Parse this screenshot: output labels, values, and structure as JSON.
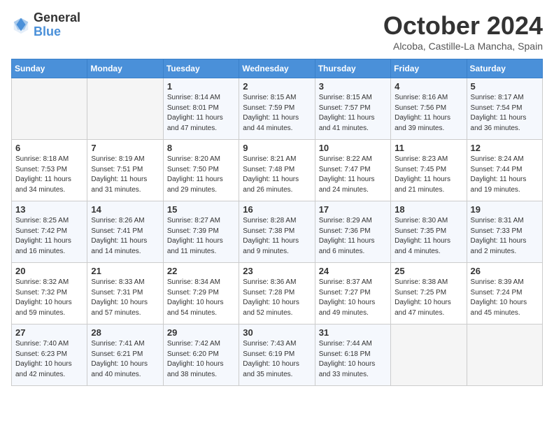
{
  "header": {
    "logo_line1": "General",
    "logo_line2": "Blue",
    "month": "October 2024",
    "location": "Alcoba, Castille-La Mancha, Spain"
  },
  "weekdays": [
    "Sunday",
    "Monday",
    "Tuesday",
    "Wednesday",
    "Thursday",
    "Friday",
    "Saturday"
  ],
  "weeks": [
    [
      {
        "day": "",
        "info": ""
      },
      {
        "day": "",
        "info": ""
      },
      {
        "day": "1",
        "info": "Sunrise: 8:14 AM\nSunset: 8:01 PM\nDaylight: 11 hours and 47 minutes."
      },
      {
        "day": "2",
        "info": "Sunrise: 8:15 AM\nSunset: 7:59 PM\nDaylight: 11 hours and 44 minutes."
      },
      {
        "day": "3",
        "info": "Sunrise: 8:15 AM\nSunset: 7:57 PM\nDaylight: 11 hours and 41 minutes."
      },
      {
        "day": "4",
        "info": "Sunrise: 8:16 AM\nSunset: 7:56 PM\nDaylight: 11 hours and 39 minutes."
      },
      {
        "day": "5",
        "info": "Sunrise: 8:17 AM\nSunset: 7:54 PM\nDaylight: 11 hours and 36 minutes."
      }
    ],
    [
      {
        "day": "6",
        "info": "Sunrise: 8:18 AM\nSunset: 7:53 PM\nDaylight: 11 hours and 34 minutes."
      },
      {
        "day": "7",
        "info": "Sunrise: 8:19 AM\nSunset: 7:51 PM\nDaylight: 11 hours and 31 minutes."
      },
      {
        "day": "8",
        "info": "Sunrise: 8:20 AM\nSunset: 7:50 PM\nDaylight: 11 hours and 29 minutes."
      },
      {
        "day": "9",
        "info": "Sunrise: 8:21 AM\nSunset: 7:48 PM\nDaylight: 11 hours and 26 minutes."
      },
      {
        "day": "10",
        "info": "Sunrise: 8:22 AM\nSunset: 7:47 PM\nDaylight: 11 hours and 24 minutes."
      },
      {
        "day": "11",
        "info": "Sunrise: 8:23 AM\nSunset: 7:45 PM\nDaylight: 11 hours and 21 minutes."
      },
      {
        "day": "12",
        "info": "Sunrise: 8:24 AM\nSunset: 7:44 PM\nDaylight: 11 hours and 19 minutes."
      }
    ],
    [
      {
        "day": "13",
        "info": "Sunrise: 8:25 AM\nSunset: 7:42 PM\nDaylight: 11 hours and 16 minutes."
      },
      {
        "day": "14",
        "info": "Sunrise: 8:26 AM\nSunset: 7:41 PM\nDaylight: 11 hours and 14 minutes."
      },
      {
        "day": "15",
        "info": "Sunrise: 8:27 AM\nSunset: 7:39 PM\nDaylight: 11 hours and 11 minutes."
      },
      {
        "day": "16",
        "info": "Sunrise: 8:28 AM\nSunset: 7:38 PM\nDaylight: 11 hours and 9 minutes."
      },
      {
        "day": "17",
        "info": "Sunrise: 8:29 AM\nSunset: 7:36 PM\nDaylight: 11 hours and 6 minutes."
      },
      {
        "day": "18",
        "info": "Sunrise: 8:30 AM\nSunset: 7:35 PM\nDaylight: 11 hours and 4 minutes."
      },
      {
        "day": "19",
        "info": "Sunrise: 8:31 AM\nSunset: 7:33 PM\nDaylight: 11 hours and 2 minutes."
      }
    ],
    [
      {
        "day": "20",
        "info": "Sunrise: 8:32 AM\nSunset: 7:32 PM\nDaylight: 10 hours and 59 minutes."
      },
      {
        "day": "21",
        "info": "Sunrise: 8:33 AM\nSunset: 7:31 PM\nDaylight: 10 hours and 57 minutes."
      },
      {
        "day": "22",
        "info": "Sunrise: 8:34 AM\nSunset: 7:29 PM\nDaylight: 10 hours and 54 minutes."
      },
      {
        "day": "23",
        "info": "Sunrise: 8:36 AM\nSunset: 7:28 PM\nDaylight: 10 hours and 52 minutes."
      },
      {
        "day": "24",
        "info": "Sunrise: 8:37 AM\nSunset: 7:27 PM\nDaylight: 10 hours and 49 minutes."
      },
      {
        "day": "25",
        "info": "Sunrise: 8:38 AM\nSunset: 7:25 PM\nDaylight: 10 hours and 47 minutes."
      },
      {
        "day": "26",
        "info": "Sunrise: 8:39 AM\nSunset: 7:24 PM\nDaylight: 10 hours and 45 minutes."
      }
    ],
    [
      {
        "day": "27",
        "info": "Sunrise: 7:40 AM\nSunset: 6:23 PM\nDaylight: 10 hours and 42 minutes."
      },
      {
        "day": "28",
        "info": "Sunrise: 7:41 AM\nSunset: 6:21 PM\nDaylight: 10 hours and 40 minutes."
      },
      {
        "day": "29",
        "info": "Sunrise: 7:42 AM\nSunset: 6:20 PM\nDaylight: 10 hours and 38 minutes."
      },
      {
        "day": "30",
        "info": "Sunrise: 7:43 AM\nSunset: 6:19 PM\nDaylight: 10 hours and 35 minutes."
      },
      {
        "day": "31",
        "info": "Sunrise: 7:44 AM\nSunset: 6:18 PM\nDaylight: 10 hours and 33 minutes."
      },
      {
        "day": "",
        "info": ""
      },
      {
        "day": "",
        "info": ""
      }
    ]
  ]
}
